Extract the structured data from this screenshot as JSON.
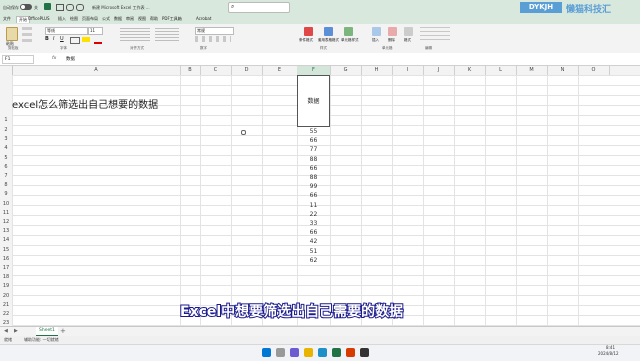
{
  "window": {
    "autosave": "自动保存",
    "autosave_state": "关",
    "title": "新建 Microsoft Excel 工作表 ..."
  },
  "ribbon_tabs": [
    "文件",
    "开始",
    "OfficePLUS",
    "插入",
    "绘图",
    "页面布局",
    "公式",
    "数据",
    "审阅",
    "视图",
    "帮助",
    "PDF工具箱",
    "Acrobat"
  ],
  "ribbon": {
    "paste": "粘贴",
    "font_name": "等线",
    "font_size": "11",
    "number_format": "常规",
    "groups": [
      "剪贴板",
      "字体",
      "对齐方式",
      "数字",
      "样式",
      "单元格",
      "编辑"
    ],
    "styles": [
      "条件格式",
      "套用表格格式",
      "单元格样式"
    ],
    "cells": [
      "插入",
      "删除",
      "格式"
    ]
  },
  "formula_bar": {
    "name_box": "F1",
    "fx": "fx",
    "value": "数据"
  },
  "columns": [
    "A",
    "B",
    "C",
    "D",
    "E",
    "F",
    "G",
    "H",
    "I",
    "J",
    "K",
    "L",
    "M",
    "N",
    "O"
  ],
  "rows": [
    "1",
    "2",
    "3",
    "4",
    "5",
    "6",
    "7",
    "8",
    "9",
    "10",
    "11",
    "12",
    "13",
    "14",
    "15",
    "16",
    "17",
    "18",
    "19",
    "20",
    "21",
    "22",
    "23"
  ],
  "sheet": {
    "title_cell": "excel怎么筛选出自己想要的数据",
    "header_cell": "数据",
    "values": [
      "55",
      "66",
      "77",
      "88",
      "66",
      "88",
      "99",
      "66",
      "11",
      "22",
      "33",
      "66",
      "42",
      "51",
      "62"
    ]
  },
  "subtitle": "Excel中想要筛选出自己需要的数据",
  "watermark": {
    "logo": "DYKJH",
    "name": "懒猫科技汇"
  },
  "sheet_tabs": [
    "Sheet1"
  ],
  "statusbar": {
    "ready": "就绪",
    "accessibility": "辅助功能: 一切就绪"
  },
  "taskbar": {
    "time": "8:41",
    "date": "2024/8/12"
  },
  "colors": {
    "accent": "#217346",
    "title_bg": "#d9e8dd",
    "subtitle_stroke": "#1a1a8c"
  }
}
